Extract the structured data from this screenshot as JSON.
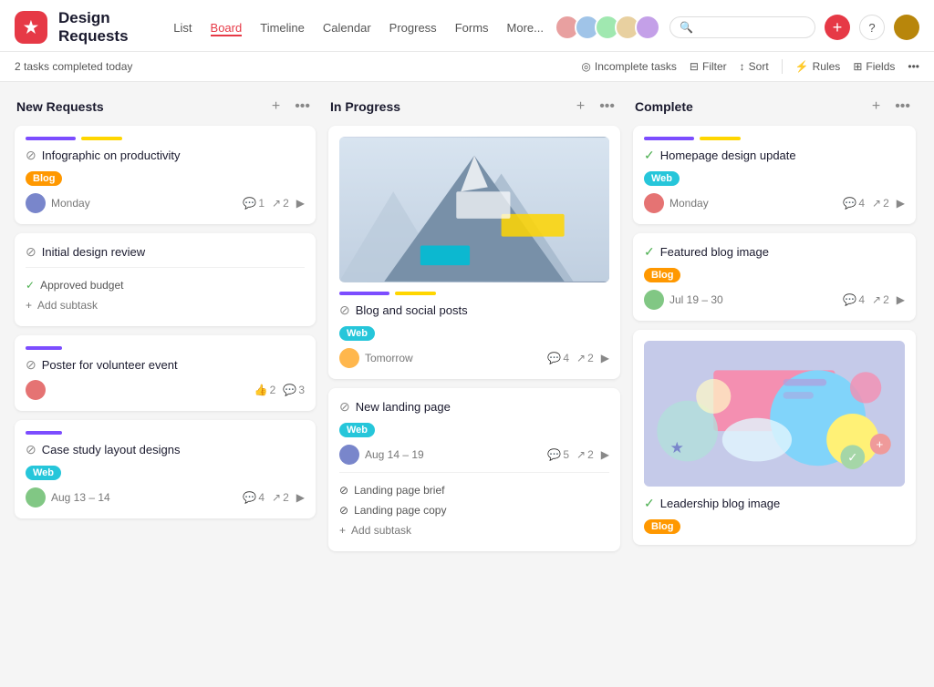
{
  "app": {
    "icon": "★",
    "title": "Design Requests",
    "nav": [
      {
        "label": "List",
        "active": false
      },
      {
        "label": "Board",
        "active": true
      },
      {
        "label": "Timeline",
        "active": false
      },
      {
        "label": "Calendar",
        "active": false
      },
      {
        "label": "Progress",
        "active": false
      },
      {
        "label": "Forms",
        "active": false
      },
      {
        "label": "More...",
        "active": false
      }
    ]
  },
  "subheader": {
    "tasks_completed": "2 tasks completed today",
    "incomplete_tasks": "Incomplete tasks",
    "filter": "Filter",
    "sort": "Sort",
    "rules": "Rules",
    "fields": "Fields"
  },
  "columns": [
    {
      "id": "new-requests",
      "title": "New Requests",
      "cards": [
        {
          "id": "c1",
          "title": "Infographic on productivity",
          "done": false,
          "tag": "Blog",
          "tag_class": "tag-blog",
          "avatar_class": "fa1",
          "date": "Monday",
          "comments": "1",
          "shares": "2"
        },
        {
          "id": "c2",
          "title": "Initial design review",
          "done": false,
          "subtasks": [
            {
              "label": "Approved budget",
              "done": true
            }
          ],
          "add_subtask": "Add subtask"
        },
        {
          "id": "c3",
          "title": "Poster for volunteer event",
          "done": false,
          "avatar_class": "fa2",
          "thumbs": "2",
          "comments": "3"
        },
        {
          "id": "c4",
          "title": "Case study layout designs",
          "done": false,
          "tag": "Web",
          "tag_class": "tag-web",
          "avatar_class": "fa3",
          "date": "Aug 13 – 14",
          "comments": "4",
          "shares": "2"
        }
      ]
    },
    {
      "id": "in-progress",
      "title": "In Progress",
      "cards": [
        {
          "id": "c5",
          "title": "Blog and social posts",
          "done": false,
          "has_image": "mountain",
          "tag": "Web",
          "tag_class": "tag-web",
          "avatar_class": "fa4",
          "date": "Tomorrow",
          "comments": "4",
          "shares": "2"
        },
        {
          "id": "c6",
          "title": "New landing page",
          "done": false,
          "tag": "Web",
          "tag_class": "tag-web",
          "avatar_class": "fa1",
          "date": "Aug 14 – 19",
          "comments": "5",
          "shares": "2",
          "subtasks": [
            {
              "label": "Landing page brief",
              "done": false
            },
            {
              "label": "Landing page copy",
              "done": false
            }
          ],
          "add_subtask": "Add subtask"
        }
      ]
    },
    {
      "id": "complete",
      "title": "Complete",
      "cards": [
        {
          "id": "c7",
          "title": "Homepage design update",
          "done": true,
          "tag": "Web",
          "tag_class": "tag-web",
          "avatar_class": "fa2",
          "date": "Monday",
          "comments": "4",
          "shares": "2"
        },
        {
          "id": "c8",
          "title": "Featured blog image",
          "done": true,
          "tag": "Blog",
          "tag_class": "tag-blog",
          "avatar_class": "fa3",
          "date": "Jul 19 – 30",
          "comments": "4",
          "shares": "2"
        },
        {
          "id": "c9",
          "title": "Leadership blog image",
          "done": true,
          "has_image": "abstract",
          "tag": "Blog",
          "tag_class": "tag-blog"
        }
      ]
    }
  ]
}
